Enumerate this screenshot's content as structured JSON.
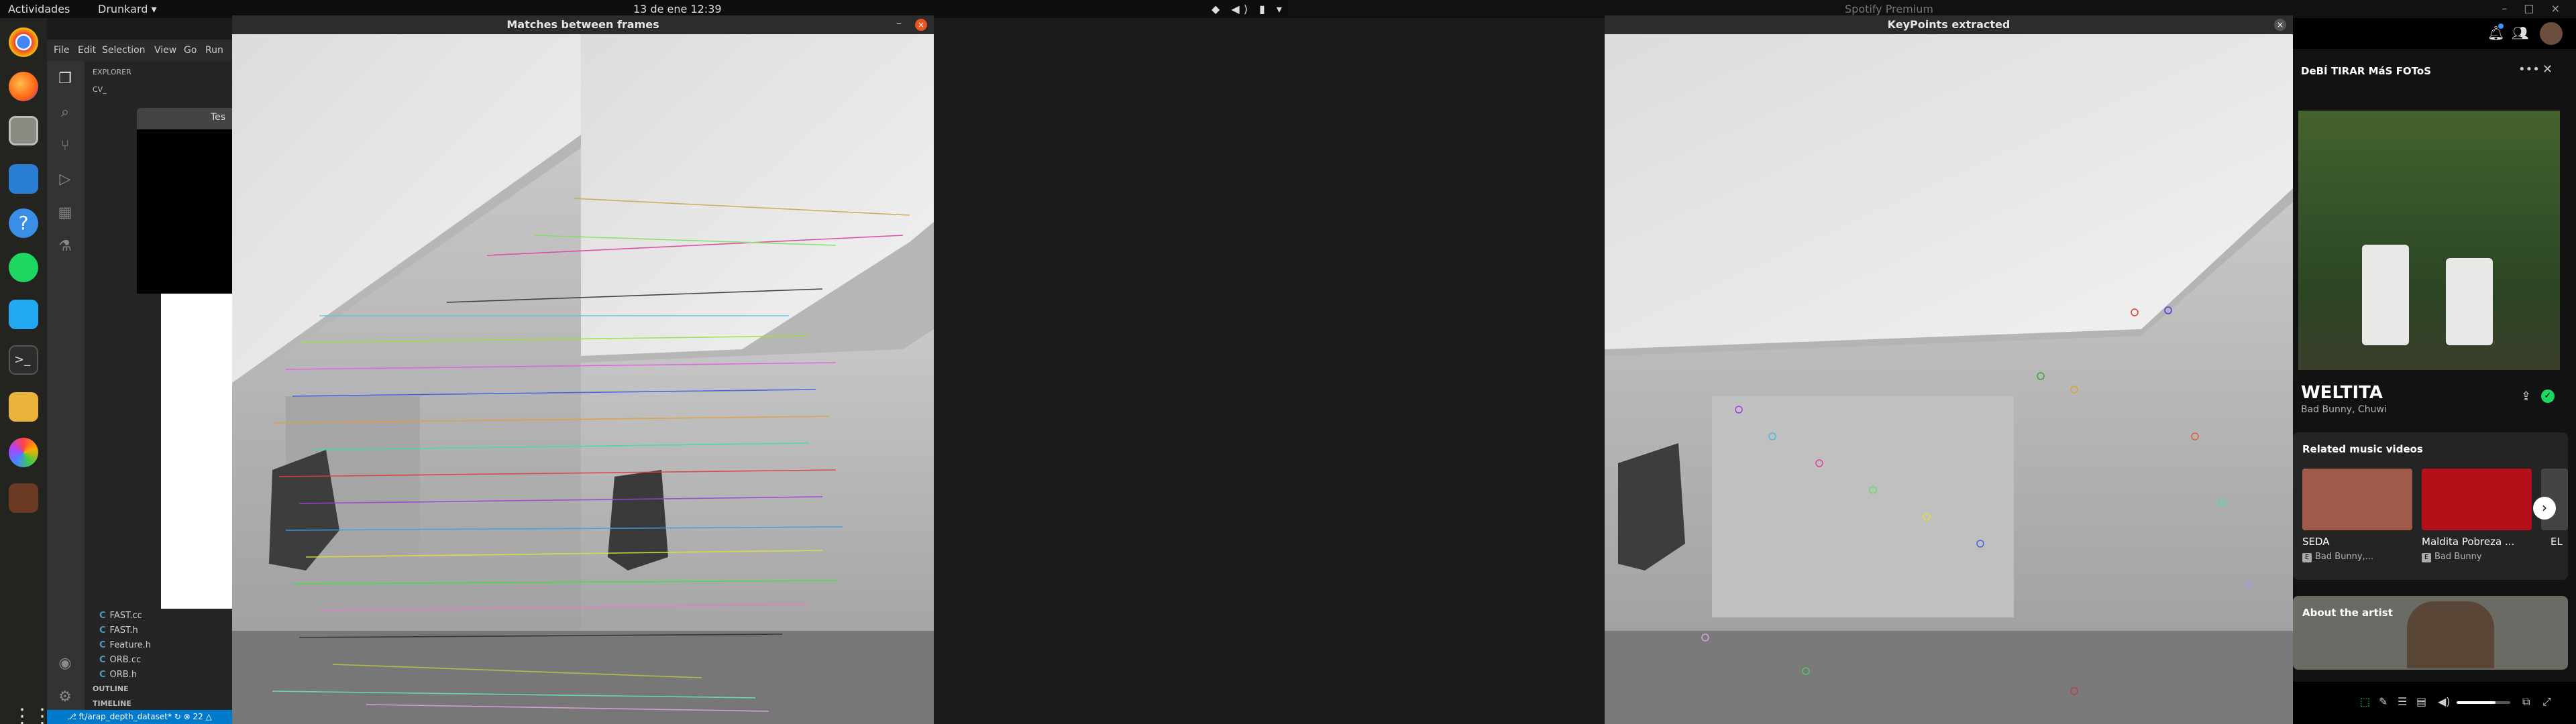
{
  "topbar": {
    "activities": "Actividades",
    "app_name": "Drunkard ▾",
    "clock": "13 de ene  12:39",
    "tray": "◆ ◀) ▮ ▾"
  },
  "topbar_right": {
    "title": "Spotify Premium"
  },
  "vscode": {
    "menu": [
      "File",
      "Edit",
      "Selection",
      "View",
      "Go",
      "Run"
    ],
    "explorer_label": "EXPLORER",
    "folder_label": "CV_",
    "files": [
      "FAST.cc",
      "FAST.h",
      "Feature.h",
      "ORB.cc",
      "ORB.h"
    ],
    "outline_label": "OUTLINE",
    "timeline_label": "TIMELINE",
    "status": "⎇ ft/arap_depth_dataset*  ↻  ⊗ 22 △",
    "dialog_title": "Tes"
  },
  "matches_window": {
    "title": "Matches between frames"
  },
  "keypoints_window": {
    "title": "KeyPoints extracted"
  },
  "spotify": {
    "panel_title": "DeBÍ TIRAR MáS FOToS",
    "track_title": "WELTITA",
    "track_artists": "Bad Bunny, Chuwi",
    "related_title": "Related music videos",
    "videos": [
      {
        "name": "SEDA",
        "artist": "Bad Bunny,..."
      },
      {
        "name": "Maldita Pobreza ...",
        "artist": "Bad Bunny"
      },
      {
        "name": "EL",
        "artist": ""
      }
    ],
    "about_title": "About the artist",
    "explicit_badge": "E"
  },
  "colors": {
    "accent_close": "#e95420",
    "spotify_green": "#1ed760",
    "vscode_status": "#007acc"
  }
}
